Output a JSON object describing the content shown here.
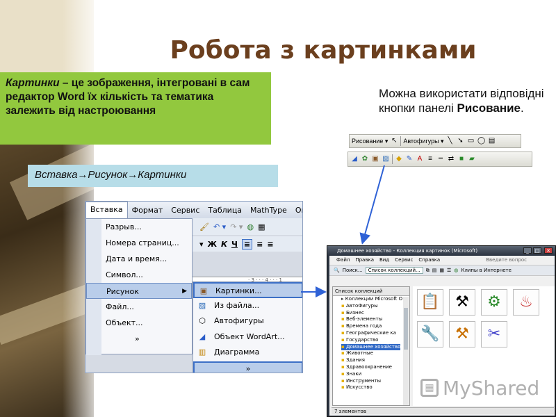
{
  "slide": {
    "title": "Робота з картинками",
    "definition_italic": "Картинки",
    "definition_rest": " – це зображення, інтегровані в сам редактор Word  їх кількість та тематика залежить від настроювання",
    "menu_path": "Вставка→Рисунок→Картинки",
    "note_prefix": "Можна використати відповідні кнопки панелі ",
    "note_bold": "Рисование",
    "note_suffix": "."
  },
  "draw_toolbar": {
    "draw_label": "Рисование ▾",
    "autoshapes_label": "Автофигуры ▾"
  },
  "word_menu": {
    "menubar": [
      "Вставка",
      "Формат",
      "Сервис",
      "Таблица",
      "MathType",
      "Окно"
    ],
    "items": [
      {
        "label": "Разрыв..."
      },
      {
        "label": "Номера страниц..."
      },
      {
        "label": "Дата и время..."
      },
      {
        "label": "Символ..."
      },
      {
        "label": "Рисунок"
      },
      {
        "label": "Файл..."
      },
      {
        "label": "Объект..."
      }
    ],
    "more": "»",
    "format_buttons": [
      "Ж",
      "К",
      "Ч"
    ],
    "submenu": [
      {
        "label": "Картинки..."
      },
      {
        "label": "Из файла..."
      },
      {
        "label": "Автофигуры"
      },
      {
        "label": "Объект WordArt..."
      },
      {
        "label": "Диаграмма"
      }
    ],
    "submenu_more": "»"
  },
  "clip_window": {
    "title": "Домашнее хозяйство - Коллекция картинок (Microsoft)",
    "menu": [
      "Файл",
      "Правка",
      "Вид",
      "Сервис",
      "Справка"
    ],
    "ask_placeholder": "Введите вопрос",
    "tools": [
      "Поиск...",
      "Список коллекций...",
      "Клипы в Интернете"
    ],
    "collections_header": "Список коллекций",
    "root": "Коллекции Microsoft O",
    "categories": [
      "АвтоФигуры",
      "Бизнес",
      "Веб-элементы",
      "Времена года",
      "Географические ка",
      "Государство",
      "Домашнее хозяйство",
      "Животные",
      "Здания",
      "Здравоохранение",
      "Знаки",
      "Инструменты",
      "Искусство"
    ],
    "selected": "Домашнее хозяйство",
    "status": "7 элементов"
  },
  "watermark": "MyShared",
  "colors": {
    "title": "#6b3f1e",
    "green_box": "#92c83e",
    "path_box": "#b7dde8",
    "arrow": "#2f62d6"
  }
}
